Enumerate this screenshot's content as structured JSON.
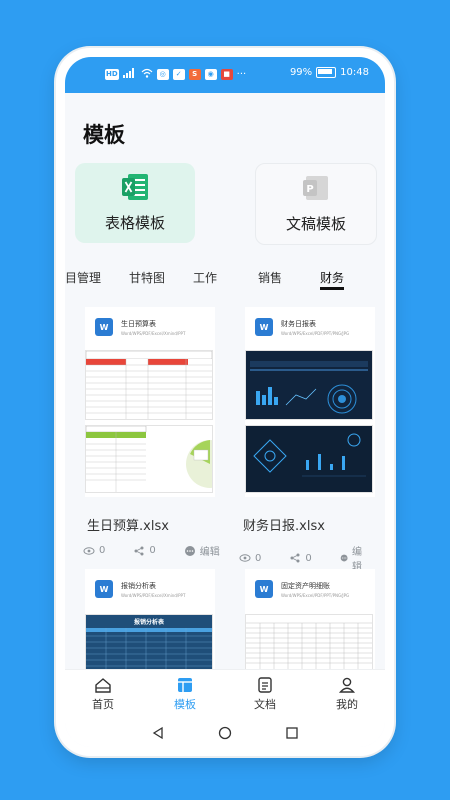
{
  "status_bar": {
    "left_icons": [
      "HD",
      "4G",
      "signal-icon",
      "wifi-icon",
      "app-icon",
      "app-icon",
      "app-icon",
      "app-icon",
      "app-icon"
    ],
    "more": "···",
    "battery": "99%",
    "time": "10:48"
  },
  "page": {
    "title": "模板"
  },
  "categories": [
    {
      "label": "表格模板",
      "icon": "spreadsheet-icon",
      "color": "#22b573",
      "selected": true
    },
    {
      "label": "文稿模板",
      "icon": "presentation-icon",
      "color": "#c9c9c9",
      "selected": false
    }
  ],
  "tabs": [
    "目管理",
    "甘特图",
    "工作",
    "销售",
    "财务"
  ],
  "active_tab": "财务",
  "templates": [
    {
      "name": "生日预算.xlsx",
      "head_title": "生日预算表",
      "head_sub": "Word/WPS/PDF/Excel/Xmind/PPT",
      "views": "0",
      "shares": "0",
      "action": ""
    },
    {
      "name": "财务日报.xlsx",
      "head_title": "财务日报表",
      "head_sub": "Word/WPS/Excel/PDF/PPT/PNG/JPG",
      "views": "0",
      "shares": "0",
      "action": "编辑"
    },
    {
      "name": "",
      "head_title": "报销分析表",
      "head_sub": "Word/WPS/PDF/Excel/Xmind/PPT",
      "thumb_title": "报销分析表"
    },
    {
      "name": "",
      "head_title": "固定资产明细账",
      "head_sub": "Word/WPS/Excel/PDF/PPT/PNG/JPG"
    }
  ],
  "first_card_action": "编辑",
  "bottom_nav": [
    {
      "label": "首页",
      "icon": "home-icon"
    },
    {
      "label": "模板",
      "icon": "template-icon",
      "active": true
    },
    {
      "label": "文档",
      "icon": "document-icon"
    },
    {
      "label": "我的",
      "icon": "profile-icon"
    }
  ],
  "colors": {
    "accent": "#2e9df2",
    "excel_green": "#22b573",
    "dark_navy": "#10243d"
  }
}
